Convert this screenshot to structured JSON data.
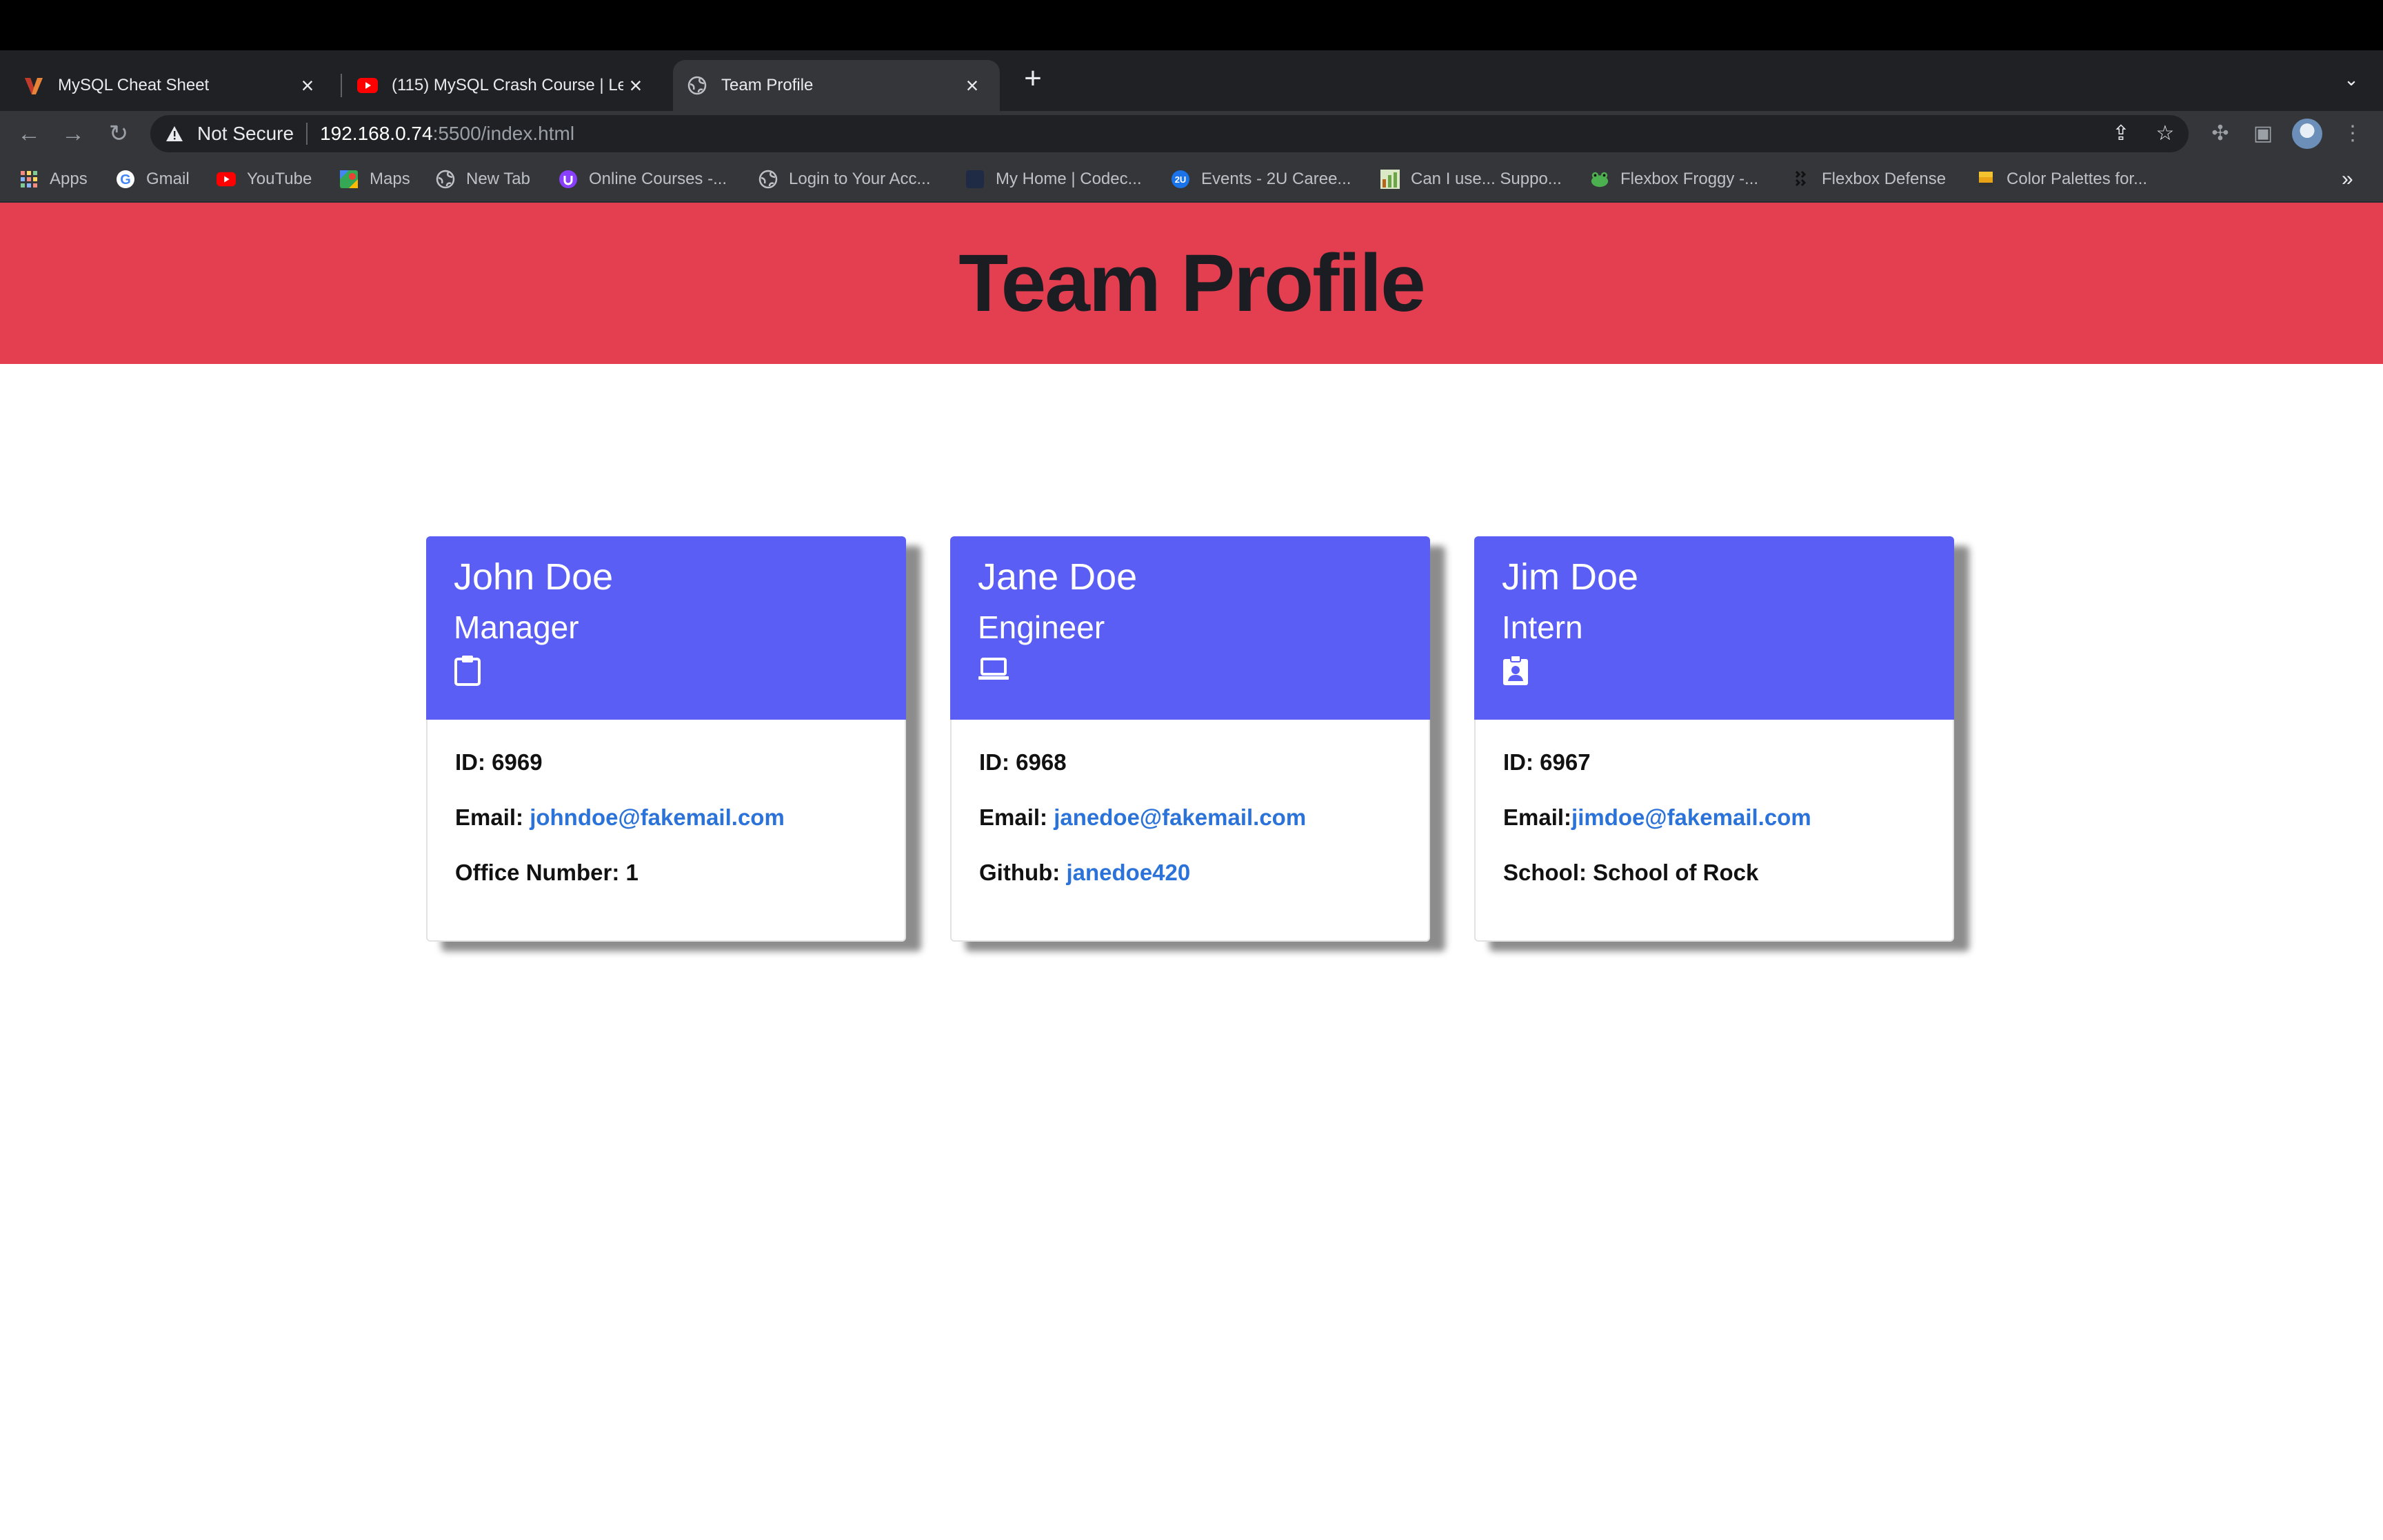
{
  "browser": {
    "tabs": [
      {
        "label": "MySQL Cheat Sheet",
        "icon": "mysql-favicon"
      },
      {
        "label": "(115) MySQL Crash Course | Le",
        "icon": "youtube-favicon"
      },
      {
        "label": "Team Profile",
        "icon": "globe-icon"
      }
    ],
    "address": {
      "security": "Not Secure",
      "host": "192.168.0.74",
      "path": ":5500/index.html"
    },
    "bookmarks": [
      {
        "label": "Apps",
        "icon": "apps-grid-icon"
      },
      {
        "label": "Gmail",
        "icon": "google-icon"
      },
      {
        "label": "YouTube",
        "icon": "youtube-icon"
      },
      {
        "label": "Maps",
        "icon": "maps-icon"
      },
      {
        "label": "New Tab",
        "icon": "globe-icon"
      },
      {
        "label": "Online Courses -...",
        "icon": "udemy-icon"
      },
      {
        "label": "Login to Your Acc...",
        "icon": "globe-icon"
      },
      {
        "label": "My Home | Codec...",
        "icon": "codecademy-icon"
      },
      {
        "label": "Events - 2U Caree...",
        "icon": "2u-icon"
      },
      {
        "label": "Can I use... Suppo...",
        "icon": "caniuse-icon"
      },
      {
        "label": "Flexbox Froggy -...",
        "icon": "frog-icon"
      },
      {
        "label": "Flexbox Defense",
        "icon": "flexbox-defense-icon"
      },
      {
        "label": "Color Palettes for...",
        "icon": "palette-icon"
      }
    ]
  },
  "page": {
    "title": "Team Profile",
    "header_color": "#e43f51",
    "card_header_color": "#5b5ef5",
    "link_color": "#2b73d9"
  },
  "team": [
    {
      "name": "John Doe",
      "role": "Manager",
      "role_icon": "clipboard-icon",
      "id_label": "ID: 6969",
      "email_label": "Email: ",
      "email": "johndoe@fakemail.com",
      "extra_label": "Office Number: 1",
      "extra_link": ""
    },
    {
      "name": "Jane Doe",
      "role": "Engineer",
      "role_icon": "laptop-icon",
      "id_label": "ID: 6968",
      "email_label": "Email: ",
      "email": "janedoe@fakemail.com",
      "extra_label": "Github: ",
      "extra_link": "janedoe420"
    },
    {
      "name": "Jim Doe",
      "role": "Intern",
      "role_icon": "badge-icon",
      "id_label": "ID: 6967",
      "email_label": "Email:",
      "email": "jimdoe@fakemail.com",
      "extra_label": "School: School of Rock",
      "extra_link": ""
    }
  ]
}
